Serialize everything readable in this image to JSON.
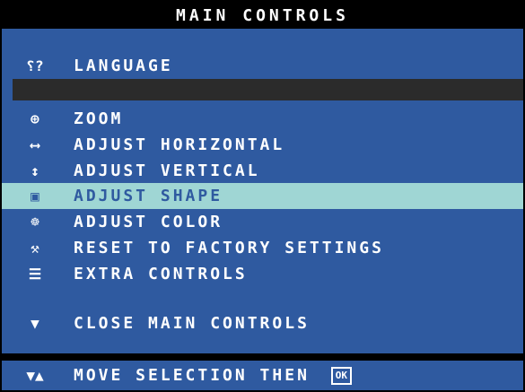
{
  "title": "MAIN CONTROLS",
  "menu": {
    "language": {
      "label": "LANGUAGE",
      "icon": "language-icon"
    },
    "items": [
      {
        "label": "ZOOM",
        "icon": "zoom-icon",
        "selected": false
      },
      {
        "label": "ADJUST HORIZONTAL",
        "icon": "horizontal-adjust-icon",
        "selected": false
      },
      {
        "label": "ADJUST VERTICAL",
        "icon": "vertical-adjust-icon",
        "selected": false
      },
      {
        "label": "ADJUST SHAPE",
        "icon": "shape-icon",
        "selected": true
      },
      {
        "label": "ADJUST COLOR",
        "icon": "color-palette-icon",
        "selected": false
      },
      {
        "label": "RESET TO FACTORY SETTINGS",
        "icon": "factory-reset-icon",
        "selected": false
      },
      {
        "label": "EXTRA CONTROLS",
        "icon": "extra-controls-icon",
        "selected": false
      }
    ],
    "close": {
      "label": "CLOSE MAIN CONTROLS",
      "icon": "down-arrow-circle-icon"
    }
  },
  "footer": {
    "label": "MOVE SELECTION THEN",
    "ok_label": "OK",
    "icon": "up-down-arrows-icon"
  },
  "colors": {
    "background": "#2f5aa0",
    "selected": "#9fd6d4",
    "title_bar": "#000000",
    "text": "#ffffff"
  }
}
